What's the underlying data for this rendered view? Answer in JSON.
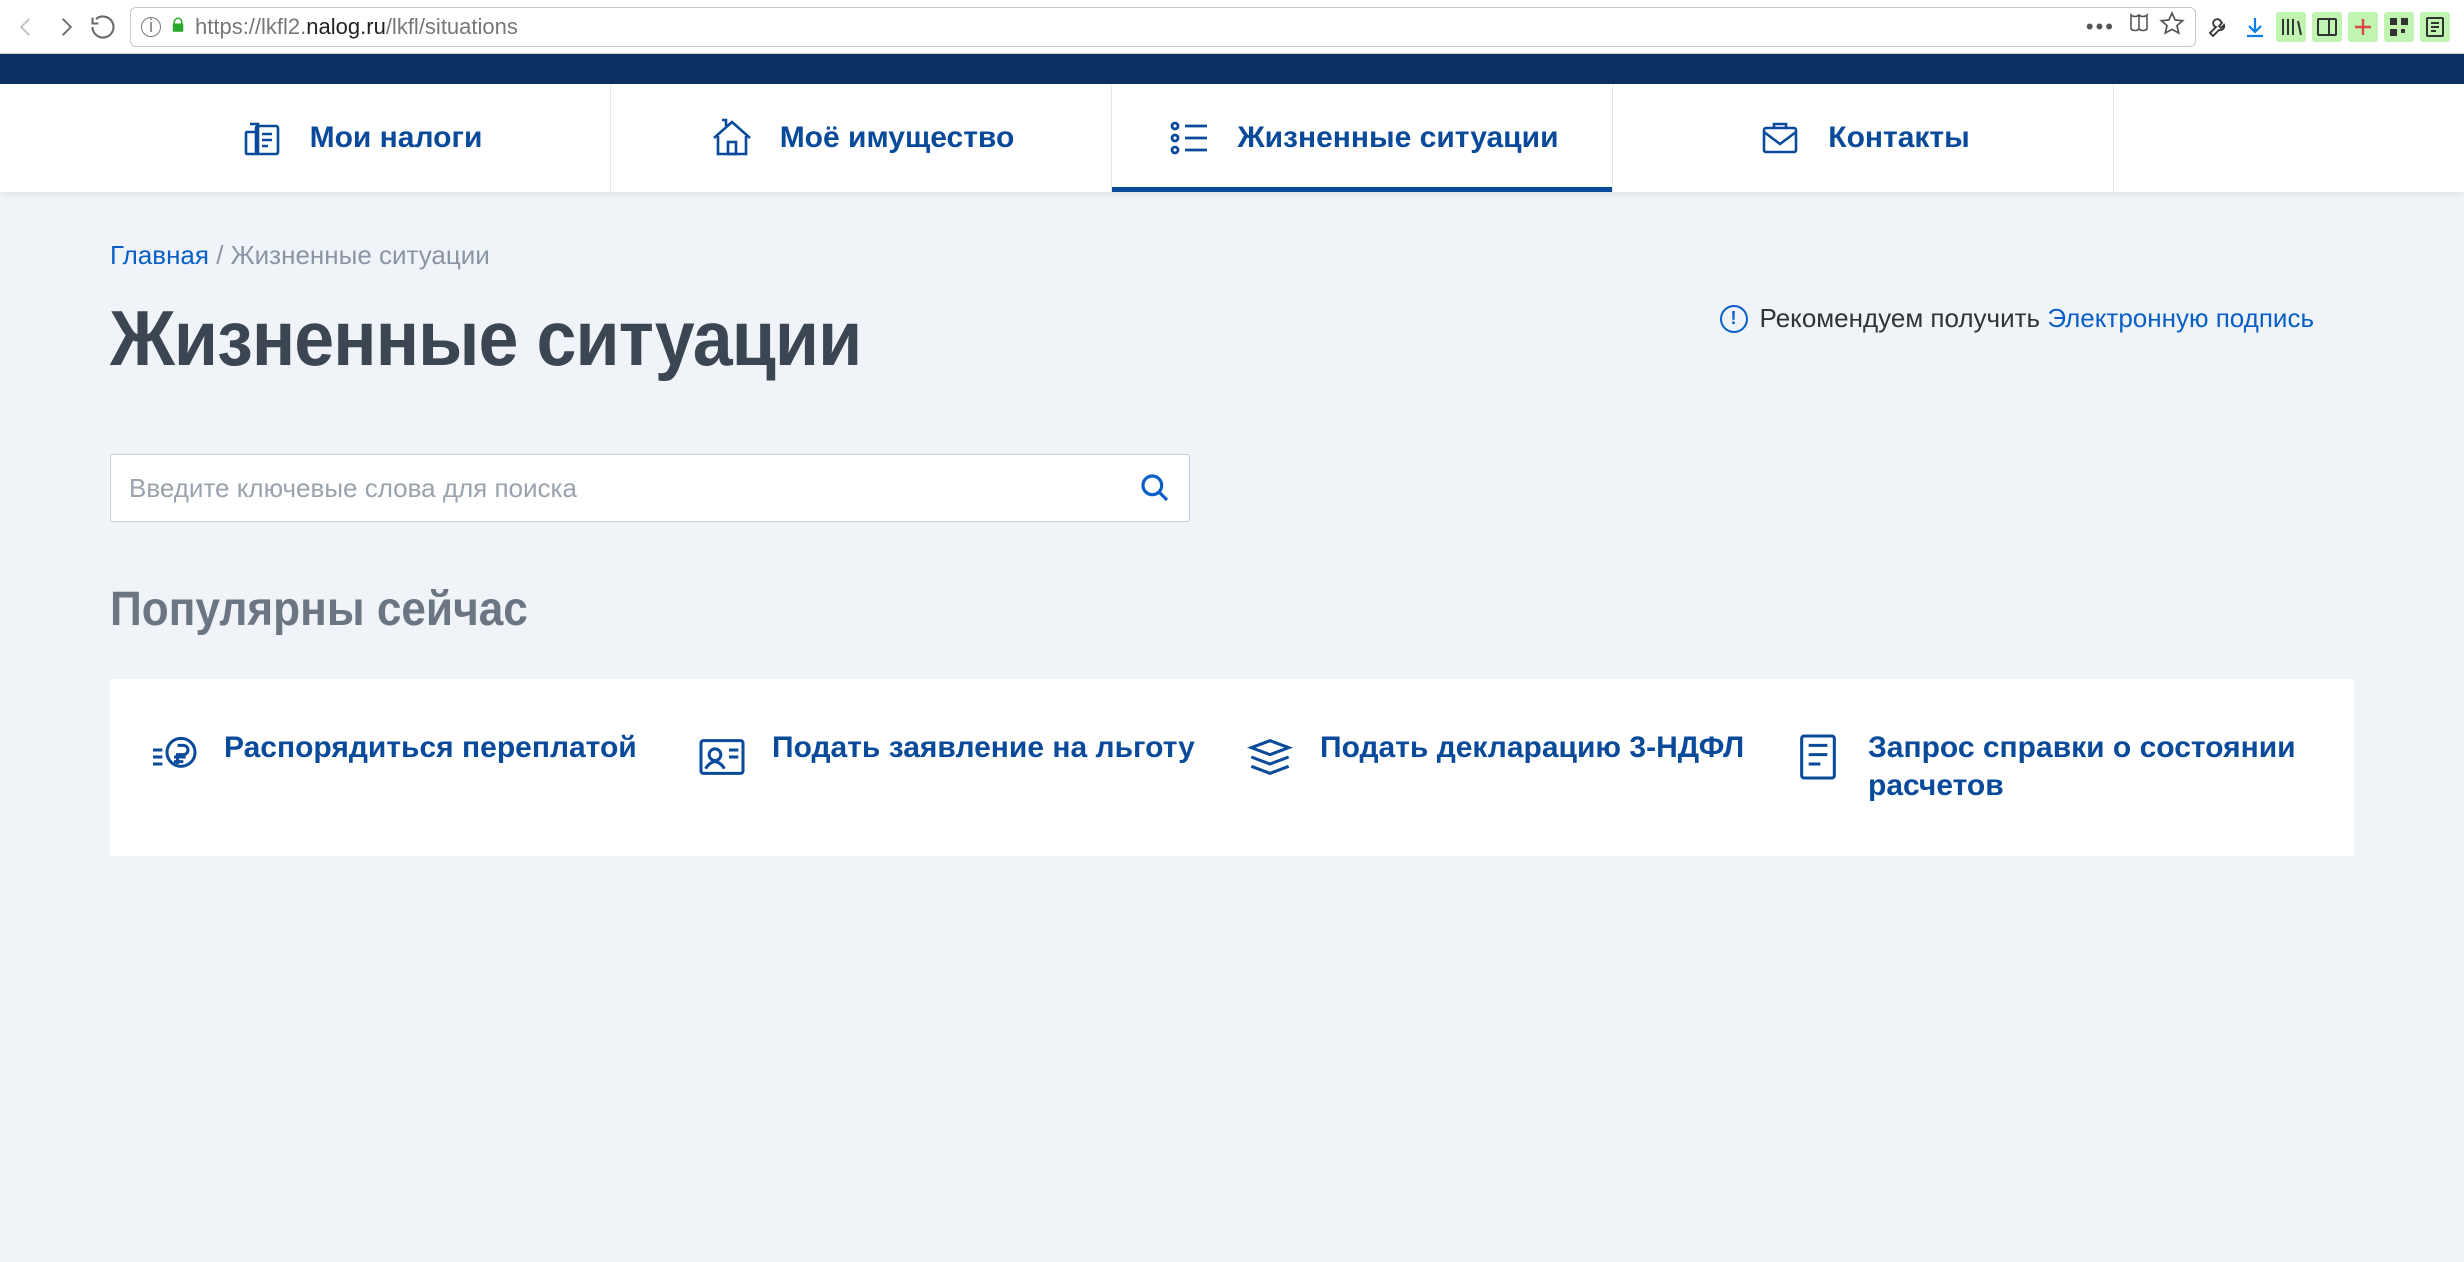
{
  "browser": {
    "url_prefix": "https://",
    "url_sub": "lkfl2.",
    "url_host": "nalog.ru",
    "url_path": "/lkfl/situations"
  },
  "nav": {
    "items": [
      {
        "label": "Мои налоги"
      },
      {
        "label": "Моё имущество"
      },
      {
        "label": "Жизненные ситуации"
      },
      {
        "label": "Контакты"
      }
    ]
  },
  "breadcrumb": {
    "home": "Главная",
    "sep": " / ",
    "current": "Жизненные ситуации"
  },
  "page": {
    "title": "Жизненные ситуации",
    "recommend_text": "Рекомендуем получить ",
    "recommend_link": "Электронную подпись"
  },
  "search": {
    "placeholder": "Введите ключевые слова для поиска"
  },
  "popular": {
    "heading": "Популярны сейчас",
    "cards": [
      {
        "title": "Распорядиться переплатой"
      },
      {
        "title": "Подать заявление на льготу"
      },
      {
        "title": "Подать декларацию 3-НДФЛ"
      },
      {
        "title": "Запрос справки о состоянии расчетов"
      }
    ]
  }
}
